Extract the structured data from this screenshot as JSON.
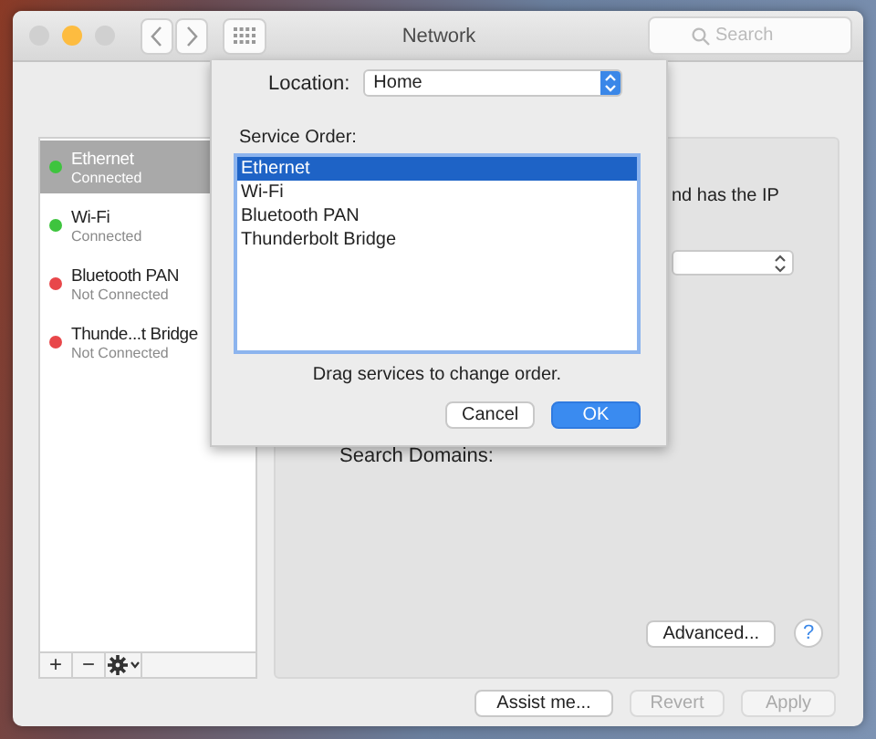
{
  "window": {
    "title": "Network",
    "controls": [
      {
        "kind": "close",
        "enabled": false
      },
      {
        "kind": "minimize",
        "enabled": true
      },
      {
        "kind": "zoom",
        "enabled": false
      }
    ],
    "search": {
      "placeholder": "Search"
    }
  },
  "sidebar": {
    "services": [
      {
        "name": "Ethernet",
        "status": "Connected",
        "color": "#3ec43e",
        "selected": true
      },
      {
        "name": "Wi-Fi",
        "status": "Connected",
        "color": "#3ec43e",
        "selected": false
      },
      {
        "name": "Bluetooth PAN",
        "status": "Not Connected",
        "color": "#e8474a",
        "selected": false
      },
      {
        "name": "Thunde...t Bridge",
        "status": "Not Connected",
        "color": "#e8474a",
        "selected": false
      }
    ],
    "toolbar": [
      "+",
      "−"
    ]
  },
  "detail": {
    "status_fragment": "nd has the IP",
    "search_domains_label": "Search Domains:",
    "advanced_button": "Advanced...",
    "help": "?"
  },
  "footer": {
    "buttons": [
      {
        "label": "Assist me...",
        "disabled": false
      },
      {
        "label": "Revert",
        "disabled": true
      },
      {
        "label": "Apply",
        "disabled": true
      }
    ]
  },
  "sheet": {
    "location_label": "Location:",
    "location": "Home",
    "service_order_label": "Service Order:",
    "services": [
      {
        "name": "Ethernet",
        "selected": true
      },
      {
        "name": "Wi-Fi",
        "selected": false
      },
      {
        "name": "Bluetooth PAN",
        "selected": false
      },
      {
        "name": "Thunderbolt Bridge",
        "selected": false
      }
    ],
    "hint": "Drag services to change order.",
    "buttons": [
      {
        "label": "Cancel",
        "default": false
      },
      {
        "label": "OK",
        "default": true
      }
    ]
  }
}
